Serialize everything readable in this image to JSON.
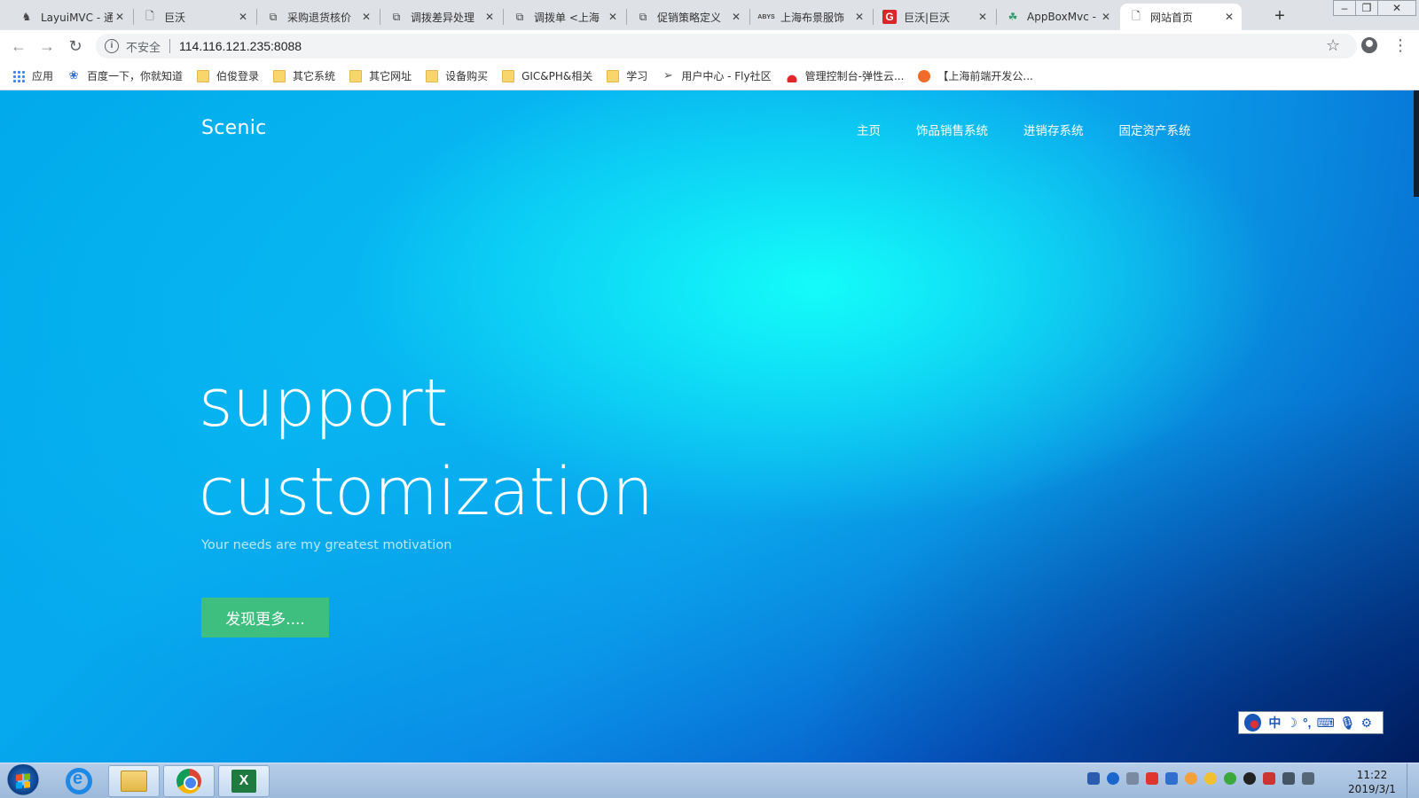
{
  "browser": {
    "tabs": [
      {
        "title": "LayuiMVC - 通",
        "favicon": "horse-logo-icon"
      },
      {
        "title": "巨沃",
        "favicon": "page-icon"
      },
      {
        "title": "采购退货核价",
        "favicon": "doc-icon"
      },
      {
        "title": "调拨差异处理",
        "favicon": "doc-icon"
      },
      {
        "title": "调拨单 <上海",
        "favicon": "doc-icon"
      },
      {
        "title": "促销策略定义",
        "favicon": "doc-icon"
      },
      {
        "title": "上海布景服饰",
        "favicon": "abys-logo-icon"
      },
      {
        "title": "巨沃|巨沃",
        "favicon": "g-logo-icon"
      },
      {
        "title": "AppBoxMvc -",
        "favicon": "leaf-logo-icon"
      },
      {
        "title": "网站首页",
        "favicon": "page-icon",
        "active": true
      }
    ],
    "new_tab": "+",
    "security_label": "不安全",
    "url": "114.116.121.235:8088",
    "bookmarks": [
      {
        "label": "应用",
        "icon": "apps-icon"
      },
      {
        "label": "百度一下，你就知道",
        "icon": "baidu-paw-icon"
      },
      {
        "label": "伯俊登录",
        "icon": "folder-icon"
      },
      {
        "label": "其它系统",
        "icon": "folder-icon"
      },
      {
        "label": "其它网址",
        "icon": "folder-icon"
      },
      {
        "label": "设备购买",
        "icon": "folder-icon"
      },
      {
        "label": "GIC&PH&相关",
        "icon": "folder-icon"
      },
      {
        "label": "学习",
        "icon": "folder-icon"
      },
      {
        "label": "用户中心 - Fly社区",
        "icon": "paper-plane-icon"
      },
      {
        "label": "管理控制台-弹性云...",
        "icon": "huawei-icon"
      },
      {
        "label": "【上海前端开发公...",
        "icon": "orange-circle-icon"
      }
    ]
  },
  "site": {
    "brand": "Scenic",
    "nav": [
      "主页",
      "饰品销售系统",
      "进销存系统",
      "固定资产系统"
    ],
    "hero_line1": "support",
    "hero_line2": "customization",
    "subtitle": "Your needs are my greatest motivation",
    "cta_label": "发现更多....",
    "colors": {
      "cta": "#3fbf7f",
      "hero_glow": "#14fffa",
      "hero_deep": "#01246a"
    }
  },
  "ime": {
    "mode": "中"
  },
  "taskbar": {
    "apps": [
      "internet-explorer-icon",
      "file-explorer-icon",
      "chrome-icon",
      "excel-icon"
    ],
    "clock_time": "11:22",
    "clock_date": "2019/3/1"
  }
}
